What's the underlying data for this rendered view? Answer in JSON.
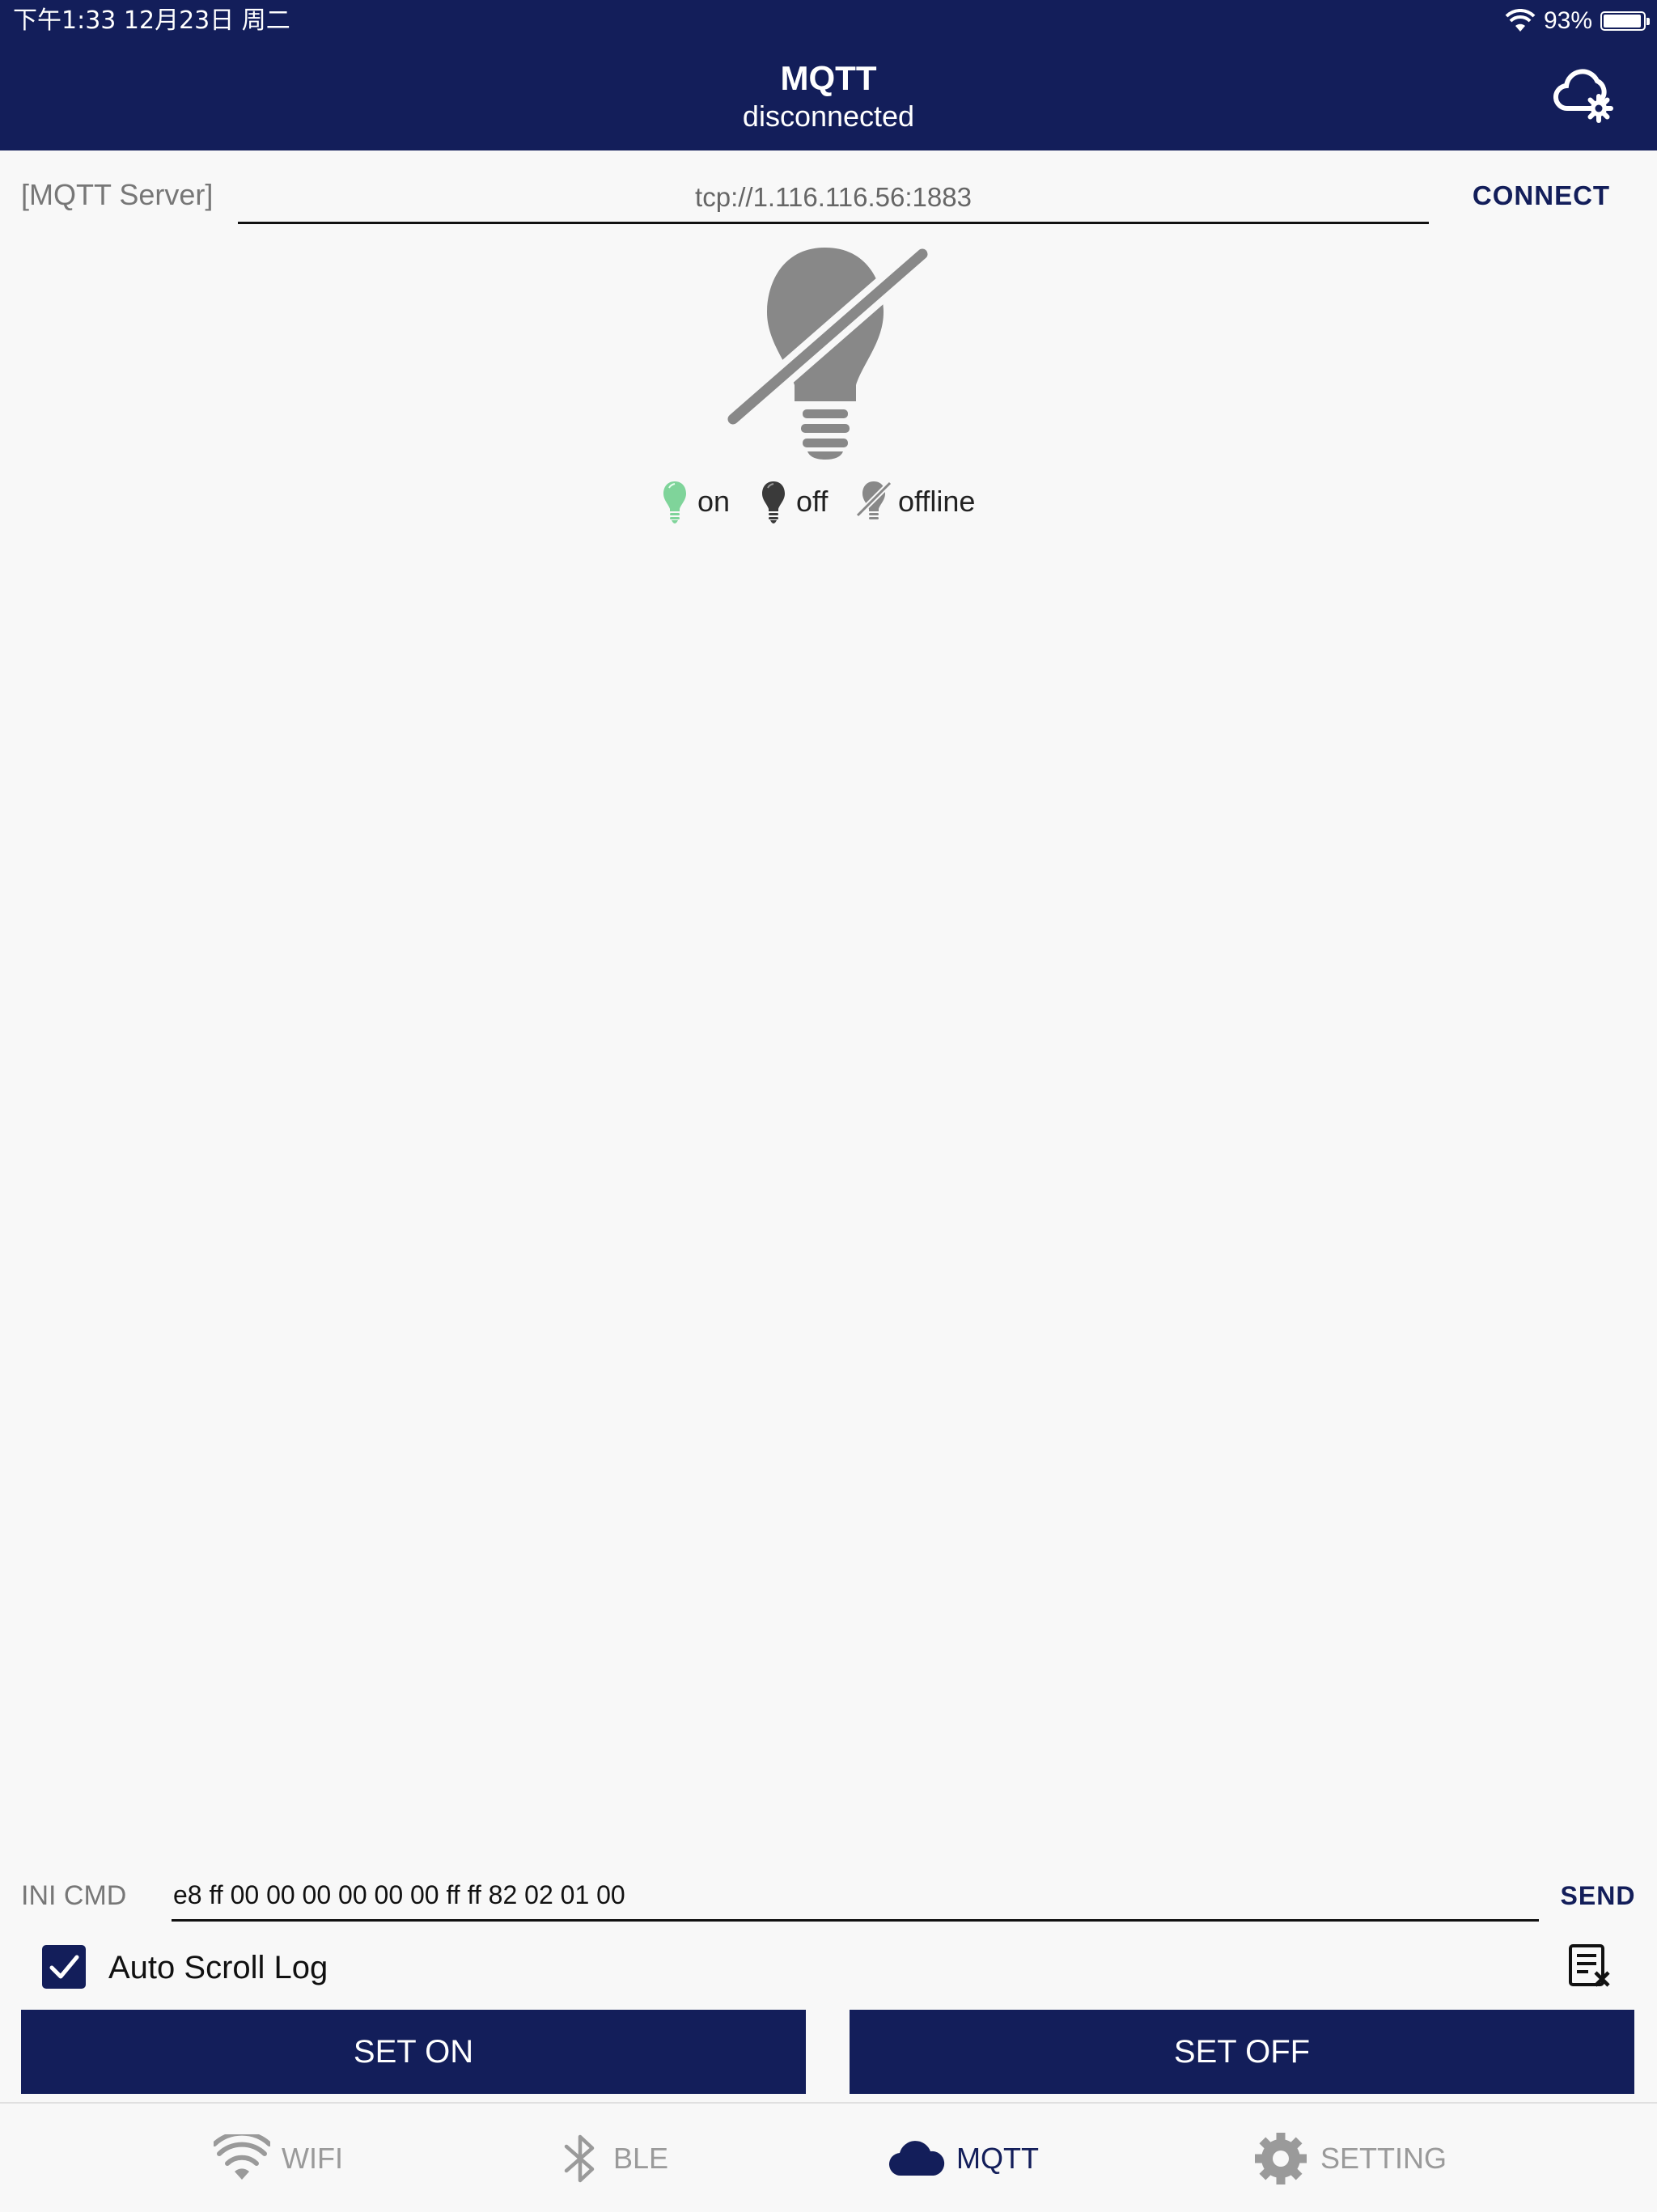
{
  "status_bar": {
    "time_date": "下午1:33   12月23日 周二",
    "battery_pct": "93%"
  },
  "header": {
    "title": "MQTT",
    "subtitle": "disconnected"
  },
  "server": {
    "label": "[MQTT Server]",
    "value": "tcp://1.116.116.56:1883",
    "connect_label": "CONNECT"
  },
  "legend": {
    "on": "on",
    "off": "off",
    "offline": "offline"
  },
  "command": {
    "label": "INI CMD",
    "value": "e8 ff 00 00 00 00 00 00 ff ff 82 02 01 00",
    "send_label": "SEND"
  },
  "log": {
    "auto_scroll_label": "Auto Scroll Log",
    "auto_scroll_checked": true
  },
  "actions": {
    "set_on": "SET ON",
    "set_off": "SET OFF"
  },
  "tabs": [
    {
      "label": "WIFI",
      "icon": "wifi-icon",
      "active": false
    },
    {
      "label": "BLE",
      "icon": "bluetooth-icon",
      "active": false
    },
    {
      "label": "MQTT",
      "icon": "cloud-icon",
      "active": true
    },
    {
      "label": "SETTING",
      "icon": "gear-icon",
      "active": false
    }
  ],
  "colors": {
    "primary": "#131e5a",
    "on": "#7fd49a",
    "off": "#3a3a3a",
    "offline": "#888888",
    "background": "#f8f8f8"
  }
}
